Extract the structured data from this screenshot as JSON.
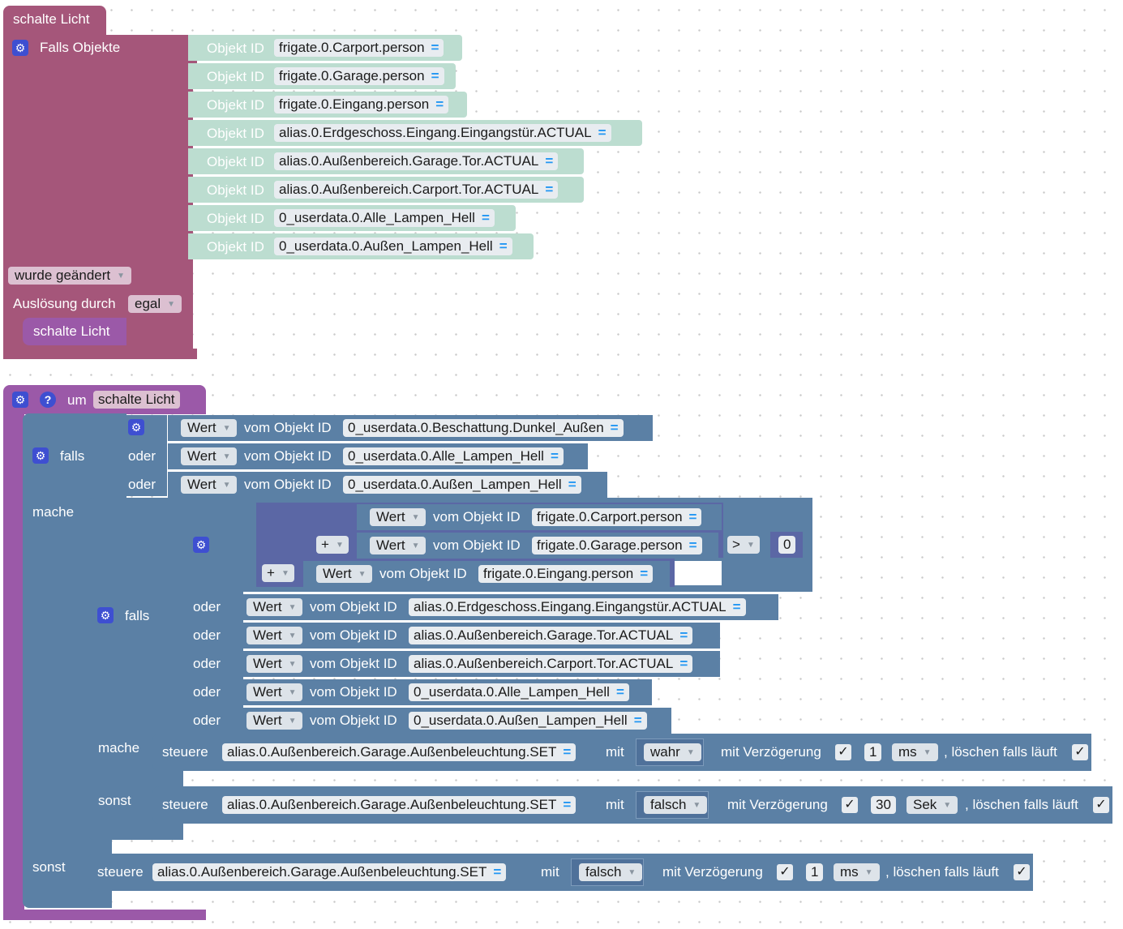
{
  "trigger_block": {
    "title": "schalte Licht",
    "header": "Falls Objekte",
    "objekt_id_label": "Objekt ID",
    "objects": [
      "frigate.0.Carport.person",
      "frigate.0.Garage.person",
      "frigate.0.Eingang.person",
      "alias.0.Erdgeschoss.Eingang.Eingangstür.ACTUAL",
      "alias.0.Außenbereich.Garage.Tor.ACTUAL",
      "alias.0.Außenbereich.Carport.Tor.ACTUAL",
      "0_userdata.0.Alle_Lampen_Hell",
      "0_userdata.0.Außen_Lampen_Hell"
    ],
    "condition_dropdown": "wurde geändert",
    "trigger_label": "Auslösung durch",
    "trigger_value": "egal",
    "call_label": "schalte Licht"
  },
  "function_block": {
    "um_label": "um",
    "name": "schalte Licht",
    "outer_if": {
      "falls_label": "falls",
      "oder_label": "oder",
      "mache_label": "mache",
      "sonst_label": "sonst",
      "conditions": [
        {
          "mode": "Wert",
          "label": "vom Objekt ID",
          "id": "0_userdata.0.Beschattung.Dunkel_Außen"
        },
        {
          "mode": "Wert",
          "label": "vom Objekt ID",
          "id": "0_userdata.0.Alle_Lampen_Hell"
        },
        {
          "mode": "Wert",
          "label": "vom Objekt ID",
          "id": "0_userdata.0.Außen_Lampen_Hell"
        }
      ]
    },
    "inner_if": {
      "falls_label": "falls",
      "oder_label": "oder",
      "mache_label": "mache",
      "sonst_label": "sonst",
      "sum": {
        "op1": "+",
        "op2": "+",
        "compare_op": ">",
        "compare_value": "0",
        "terms": [
          {
            "mode": "Wert",
            "label": "vom Objekt ID",
            "id": "frigate.0.Carport.person"
          },
          {
            "mode": "Wert",
            "label": "vom Objekt ID",
            "id": "frigate.0.Garage.person"
          },
          {
            "mode": "Wert",
            "label": "vom Objekt ID",
            "id": "frigate.0.Eingang.person"
          }
        ]
      },
      "conditions": [
        {
          "mode": "Wert",
          "label": "vom Objekt ID",
          "id": "alias.0.Erdgeschoss.Eingang.Eingangstür.ACTUAL"
        },
        {
          "mode": "Wert",
          "label": "vom Objekt ID",
          "id": "alias.0.Außenbereich.Garage.Tor.ACTUAL"
        },
        {
          "mode": "Wert",
          "label": "vom Objekt ID",
          "id": "alias.0.Außenbereich.Carport.Tor.ACTUAL"
        },
        {
          "mode": "Wert",
          "label": "vom Objekt ID",
          "id": "0_userdata.0.Alle_Lampen_Hell"
        },
        {
          "mode": "Wert",
          "label": "vom Objekt ID",
          "id": "0_userdata.0.Außen_Lampen_Hell"
        }
      ]
    },
    "actions": [
      {
        "steuere": "steuere",
        "target": "alias.0.Außenbereich.Garage.Außenbeleuchtung.SET",
        "mit": "mit",
        "value": "wahr",
        "delay_label": "mit Verzögerung",
        "delay": "1",
        "unit": "ms",
        "clear_label": ", löschen falls läuft"
      },
      {
        "steuere": "steuere",
        "target": "alias.0.Außenbereich.Garage.Außenbeleuchtung.SET",
        "mit": "mit",
        "value": "falsch",
        "delay_label": "mit Verzögerung",
        "delay": "30",
        "unit": "Sek",
        "clear_label": ", löschen falls läuft"
      },
      {
        "steuere": "steuere",
        "target": "alias.0.Außenbereich.Garage.Außenbeleuchtung.SET",
        "mit": "mit",
        "value": "falsch",
        "delay_label": "mit Verzögerung",
        "delay": "1",
        "unit": "ms",
        "clear_label": ", löschen falls läuft"
      }
    ],
    "check_mark": "✓",
    "eq_mark": "="
  },
  "colors": {
    "event": "#a5567a",
    "function": "#9b59a8",
    "logic": "#5b80a5",
    "math": "#5b67a5",
    "object_id": "#bcddd0",
    "gear": "#3e4fd1"
  },
  "icons": [
    "gear-icon",
    "help-icon",
    "dropdown-arrow-icon",
    "checkbox-check-icon"
  ]
}
